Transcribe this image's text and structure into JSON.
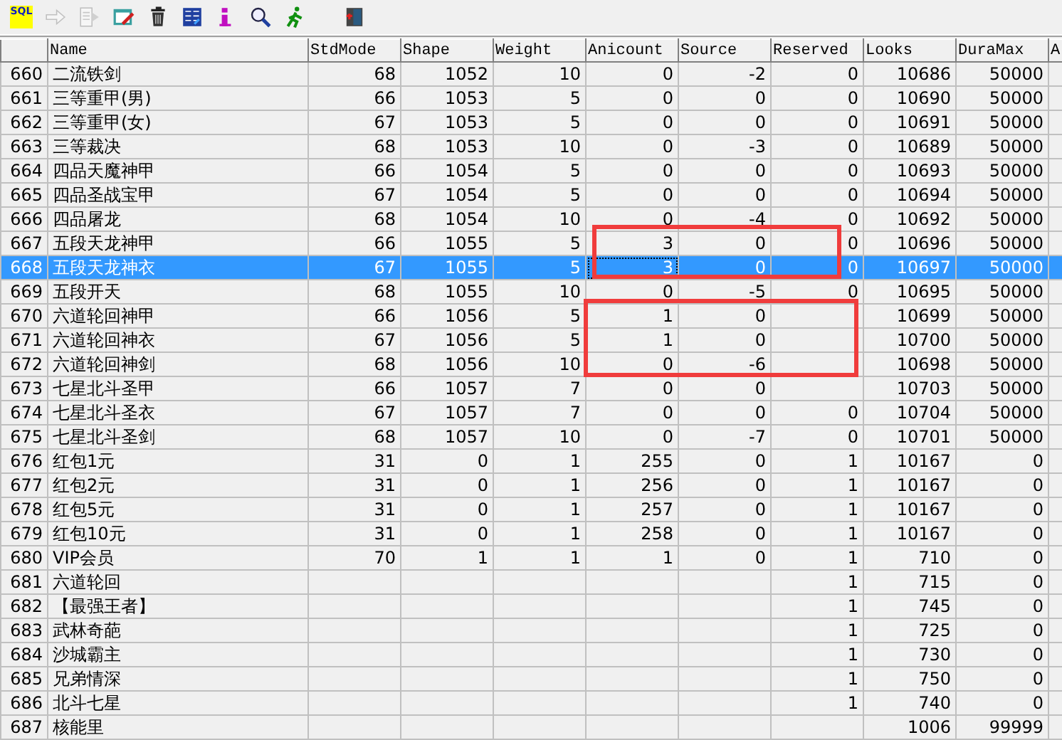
{
  "toolbar": [
    {
      "kind": "sql",
      "label": "SQL",
      "disabled": false
    },
    {
      "kind": "arrow",
      "disabled": true
    },
    {
      "kind": "doc",
      "disabled": true
    },
    {
      "kind": "edit",
      "disabled": false
    },
    {
      "kind": "trash",
      "disabled": false
    },
    {
      "kind": "db",
      "disabled": false
    },
    {
      "kind": "info",
      "disabled": false
    },
    {
      "kind": "find",
      "disabled": false
    },
    {
      "kind": "run",
      "disabled": false
    },
    {
      "kind": "exit",
      "disabled": false
    }
  ],
  "table": {
    "columns": [
      {
        "kind": "rownum"
      },
      {
        "kind": "text",
        "label": "Name"
      },
      {
        "kind": "num",
        "label": "StdMode"
      },
      {
        "kind": "num",
        "label": "Shape"
      },
      {
        "kind": "num",
        "label": "Weight"
      },
      {
        "kind": "num",
        "label": "Anicount"
      },
      {
        "kind": "num",
        "label": "Source"
      },
      {
        "kind": "num",
        "label": "Reserved"
      },
      {
        "kind": "num",
        "label": "Looks"
      },
      {
        "kind": "num",
        "label": "DuraMax"
      },
      {
        "kind": "num",
        "label": "A"
      }
    ],
    "rows": [
      {
        "selected": false,
        "cells": [
          "660",
          "二流铁剑",
          "68",
          "1052",
          "10",
          "0",
          "-2",
          "0",
          "10686",
          "50000",
          null
        ]
      },
      {
        "selected": false,
        "cells": [
          "661",
          "三等重甲(男)",
          "66",
          "1053",
          "5",
          "0",
          "0",
          "0",
          "10690",
          "50000",
          null
        ]
      },
      {
        "selected": false,
        "cells": [
          "662",
          "三等重甲(女)",
          "67",
          "1053",
          "5",
          "0",
          "0",
          "0",
          "10691",
          "50000",
          null
        ]
      },
      {
        "selected": false,
        "cells": [
          "663",
          "三等裁决",
          "68",
          "1053",
          "10",
          "0",
          "-3",
          "0",
          "10689",
          "50000",
          null
        ]
      },
      {
        "selected": false,
        "cells": [
          "664",
          "四品天魔神甲",
          "66",
          "1054",
          "5",
          "0",
          "0",
          "0",
          "10693",
          "50000",
          null
        ]
      },
      {
        "selected": false,
        "cells": [
          "665",
          "四品圣战宝甲",
          "67",
          "1054",
          "5",
          "0",
          "0",
          "0",
          "10694",
          "50000",
          null
        ]
      },
      {
        "selected": false,
        "cells": [
          "666",
          "四品屠龙",
          "68",
          "1054",
          "10",
          "0",
          "-4",
          "0",
          "10692",
          "50000",
          null
        ]
      },
      {
        "selected": false,
        "cells": [
          "667",
          "五段天龙神甲",
          "66",
          "1055",
          "5",
          "3",
          "0",
          "0",
          "10696",
          "50000",
          null
        ]
      },
      {
        "selected": true,
        "cells": [
          "668",
          "五段天龙神衣",
          "67",
          "1055",
          "5",
          "3",
          "0",
          "0",
          "10697",
          "50000",
          null
        ]
      },
      {
        "selected": false,
        "cells": [
          "669",
          "五段开天",
          "68",
          "1055",
          "10",
          "0",
          "-5",
          "0",
          "10695",
          "50000",
          null
        ]
      },
      {
        "selected": false,
        "cells": [
          "670",
          "六道轮回神甲",
          "66",
          "1056",
          "5",
          "1",
          "0",
          null,
          "10699",
          "50000",
          null
        ]
      },
      {
        "selected": false,
        "cells": [
          "671",
          "六道轮回神衣",
          "67",
          "1056",
          "5",
          "1",
          "0",
          null,
          "10700",
          "50000",
          null
        ]
      },
      {
        "selected": false,
        "cells": [
          "672",
          "六道轮回神剑",
          "68",
          "1056",
          "10",
          "0",
          "-6",
          null,
          "10698",
          "50000",
          null
        ]
      },
      {
        "selected": false,
        "cells": [
          "673",
          "七星北斗圣甲",
          "66",
          "1057",
          "7",
          "0",
          "0",
          null,
          "10703",
          "50000",
          null
        ]
      },
      {
        "selected": false,
        "cells": [
          "674",
          "七星北斗圣衣",
          "67",
          "1057",
          "7",
          "0",
          "0",
          "0",
          "10704",
          "50000",
          null
        ]
      },
      {
        "selected": false,
        "cells": [
          "675",
          "七星北斗圣剑",
          "68",
          "1057",
          "10",
          "0",
          "-7",
          "0",
          "10701",
          "50000",
          null
        ]
      },
      {
        "selected": false,
        "cells": [
          "676",
          "红包1元",
          "31",
          "0",
          "1",
          "255",
          "0",
          "1",
          "10167",
          "0",
          null
        ]
      },
      {
        "selected": false,
        "cells": [
          "677",
          "红包2元",
          "31",
          "0",
          "1",
          "256",
          "0",
          "1",
          "10167",
          "0",
          null
        ]
      },
      {
        "selected": false,
        "cells": [
          "678",
          "红包5元",
          "31",
          "0",
          "1",
          "257",
          "0",
          "1",
          "10167",
          "0",
          null
        ]
      },
      {
        "selected": false,
        "cells": [
          "679",
          "红包10元",
          "31",
          "0",
          "1",
          "258",
          "0",
          "1",
          "10167",
          "0",
          null
        ]
      },
      {
        "selected": false,
        "cells": [
          "680",
          "VIP会员",
          "70",
          "1",
          "1",
          "1",
          "0",
          "1",
          "710",
          "0",
          null
        ]
      },
      {
        "selected": false,
        "cells": [
          "681",
          "六道轮回",
          null,
          null,
          null,
          null,
          null,
          "1",
          "715",
          "0",
          null
        ]
      },
      {
        "selected": false,
        "cells": [
          "682",
          "【最强王者】",
          null,
          null,
          null,
          null,
          null,
          "1",
          "745",
          "0",
          null
        ]
      },
      {
        "selected": false,
        "cells": [
          "683",
          "武林奇葩",
          null,
          null,
          null,
          null,
          null,
          "1",
          "725",
          "0",
          null
        ]
      },
      {
        "selected": false,
        "cells": [
          "684",
          "沙城霸主",
          null,
          null,
          null,
          null,
          null,
          "1",
          "730",
          "0",
          null
        ]
      },
      {
        "selected": false,
        "cells": [
          "685",
          "兄弟情深",
          null,
          null,
          null,
          null,
          null,
          "1",
          "750",
          "0",
          null
        ]
      },
      {
        "selected": false,
        "cells": [
          "686",
          "北斗七星",
          null,
          null,
          null,
          null,
          null,
          "1",
          "740",
          "0",
          null
        ]
      },
      {
        "selected": false,
        "cells": [
          "687",
          "核能里",
          null,
          null,
          null,
          null,
          null,
          null,
          "1006",
          "99999",
          null
        ]
      }
    ]
  },
  "annotation_frames": [
    {
      "kind": "frame"
    },
    {
      "kind": "frame"
    }
  ]
}
